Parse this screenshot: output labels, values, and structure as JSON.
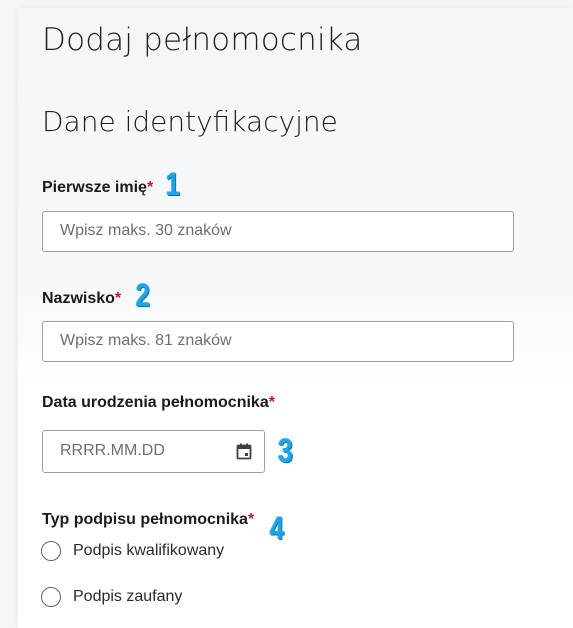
{
  "form": {
    "title": "Dodaj pełnomocnika",
    "section_title": "Dane identyfikacyjne",
    "required_mark": "*",
    "first_name": {
      "label": "Pierwsze imię",
      "marker": "1",
      "placeholder": "Wpisz maks. 30 znaków"
    },
    "last_name": {
      "label": "Nazwisko",
      "marker": "2",
      "placeholder": "Wpisz maks. 81 znaków"
    },
    "birth_date": {
      "label": "Data urodzenia pełnomocnika",
      "marker": "3",
      "placeholder": "RRRR.MM.DD",
      "icon": "calendar-icon"
    },
    "signature_type": {
      "label": "Typ podpisu pełnomocnika",
      "marker": "4",
      "options": [
        "Podpis kwalifikowany",
        "Podpis zaufany"
      ]
    }
  },
  "colors": {
    "required": "#c8102e",
    "marker": "#1ea5e6",
    "border": "#9aa0a6"
  }
}
